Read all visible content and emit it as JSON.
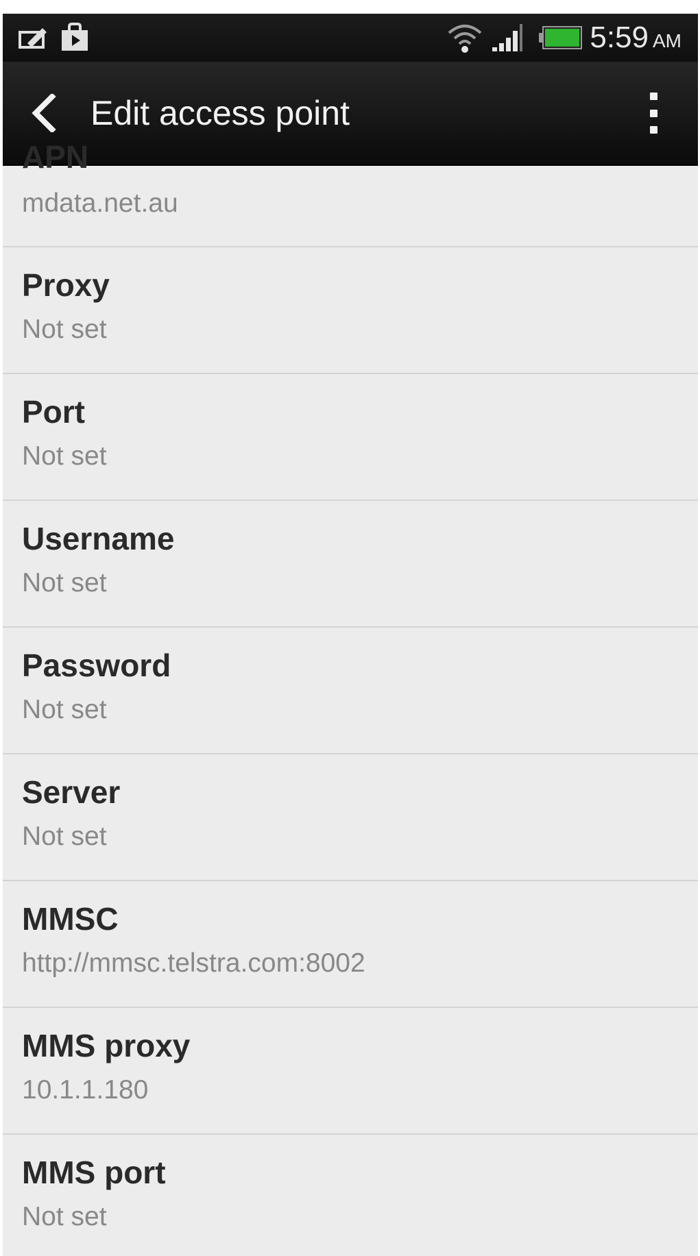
{
  "status_bar": {
    "time": "5:59",
    "ampm": "AM",
    "icons": [
      "edit-note-icon",
      "shopping-bag-icon",
      "wifi-icon",
      "signal-icon",
      "battery-icon"
    ],
    "battery_color": "#2fb52f"
  },
  "app_bar": {
    "title": "Edit access point",
    "back_icon": "chevron-left-icon",
    "menu_icon": "overflow-menu-icon"
  },
  "settings": [
    {
      "title": "APN",
      "value": "mdata.net.au"
    },
    {
      "title": "Proxy",
      "value": "Not set"
    },
    {
      "title": "Port",
      "value": "Not set"
    },
    {
      "title": "Username",
      "value": "Not set"
    },
    {
      "title": "Password",
      "value": "Not set"
    },
    {
      "title": "Server",
      "value": "Not set"
    },
    {
      "title": "MMSC",
      "value": "http://mmsc.telstra.com:8002"
    },
    {
      "title": "MMS proxy",
      "value": "10.1.1.180"
    },
    {
      "title": "MMS port",
      "value": "Not set"
    }
  ]
}
